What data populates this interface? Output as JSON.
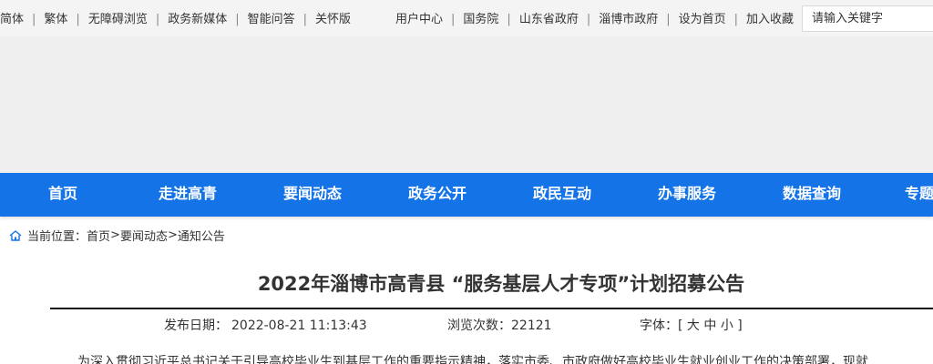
{
  "topbar": {
    "left": [
      {
        "label": "简体",
        "name": "simplified-link"
      },
      {
        "label": "繁体",
        "name": "traditional-link"
      },
      {
        "label": "无障碍浏览",
        "name": "accessibility-link"
      },
      {
        "label": "政务新媒体",
        "name": "new-media-link"
      },
      {
        "label": "智能问答",
        "name": "smart-qa-link"
      },
      {
        "label": "关怀版",
        "name": "care-version-link"
      }
    ],
    "right": [
      {
        "label": "用户中心",
        "name": "user-center-link"
      },
      {
        "label": "国务院",
        "name": "state-council-link"
      },
      {
        "label": "山东省政府",
        "name": "shandong-gov-link"
      },
      {
        "label": "淄博市政府",
        "name": "zibo-gov-link"
      },
      {
        "label": "设为首页",
        "name": "set-homepage-link"
      },
      {
        "label": "加入收藏",
        "name": "add-favorite-link"
      }
    ],
    "search_placeholder": "请输入关键字"
  },
  "nav": {
    "items": [
      "首页",
      "走进高青",
      "要闻动态",
      "政务公开",
      "政民互动",
      "办事服务",
      "数据查询",
      "专题"
    ]
  },
  "breadcrumb": {
    "prefix": "当前位置：",
    "items": [
      "首页",
      "要闻动态",
      "通知公告"
    ],
    "separator": ">"
  },
  "article": {
    "title": "2022年淄博市高青县 “服务基层人才专项”计划招募公告",
    "publish_label": "发布日期：",
    "publish_date": "2022-08-21 11:13:43",
    "views_label": "浏览次数：",
    "views": "22121",
    "font_label": "字体：[",
    "font_large": "大",
    "font_medium": "中",
    "font_small": "小",
    "font_close": "]",
    "body_line": "为深入贯彻习近平总书记关于引导高校毕业生到基层工作的重要指示精神，落实市委、市政府做好高校毕业生就业创业工作的决策部署，现就"
  },
  "colors": {
    "nav_bg": "#1473e6",
    "topbar_bg": "#f4f4f4",
    "banner_bg": "#efefef"
  }
}
